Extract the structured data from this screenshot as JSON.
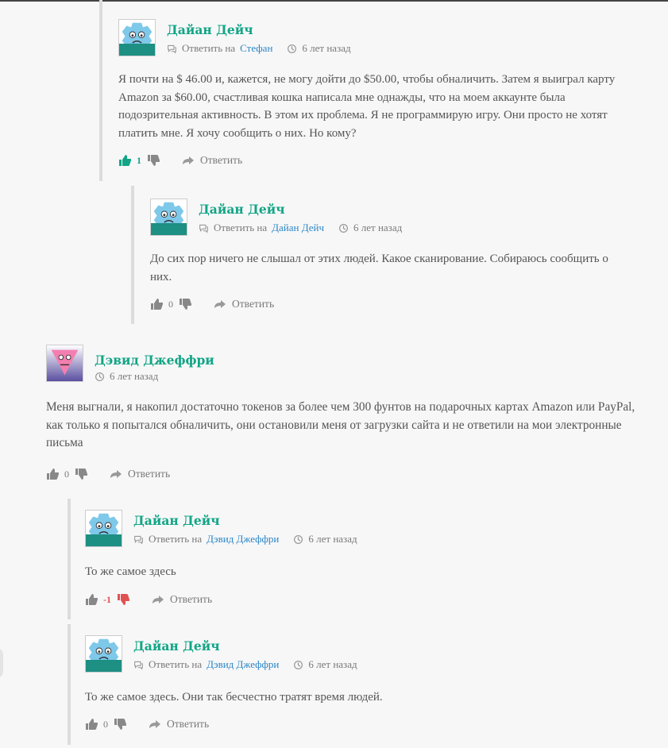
{
  "comments": [
    {
      "author": "Дайан Дейч",
      "reply_label": "Ответить на",
      "reply_to": "Стефан",
      "time": "6 лет назад",
      "text": "Я почти на $ 46.00 и, кажется, не могу дойти до $50.00, чтобы обналичить. Затем я выиграл карту Amazon за $60.00, счастливая кошка написала мне однажды, что на моем аккаунте была подозрительная активность. В этом их проблема. Я не программирую игру. Они просто не хотят платить мне. Я хочу сообщить о них. Но кому?",
      "votes": "1",
      "reply_button": "Ответить",
      "avatar": "gear-face-icon"
    },
    {
      "author": "Дайан Дейч",
      "reply_label": "Ответить на",
      "reply_to": "Дайан Дейч",
      "time": "6 лет назад",
      "text": "До сих пор ничего не слышал от этих людей. Какое сканирование. Собираюсь сообщить о них.",
      "votes": "0",
      "reply_button": "Ответить",
      "avatar": "gear-face-icon"
    },
    {
      "author": "Дэвид Джеффри",
      "time": "6 лет назад",
      "text": "Меня выгнали, я накопил достаточно токенов за более чем 300 фунтов на подарочных картах Amazon или PayPal, как только я попытался обналичить, они остановили меня от загрузки сайта и не ответили на мои электронные письма",
      "votes": "0",
      "reply_button": "Ответить",
      "avatar": "triangle-face-icon"
    },
    {
      "author": "Дайан Дейч",
      "reply_label": "Ответить на",
      "reply_to": "Дэвид Джеффри",
      "time": "6 лет назад",
      "text": "То же самое здесь",
      "votes": "-1",
      "reply_button": "Ответить",
      "avatar": "gear-face-icon"
    },
    {
      "author": "Дайан Дейч",
      "reply_label": "Ответить на",
      "reply_to": "Дэвид Джеффри",
      "time": "6 лет назад",
      "text": "То же самое здесь. Они так бесчестно тратят время людей.",
      "votes": "0",
      "reply_button": "Ответить",
      "avatar": "gear-face-icon"
    }
  ],
  "colors": {
    "author": "#12a585",
    "link": "#2b86c5",
    "upvote_active": "#12a585",
    "downvote_active": "#e05252",
    "nested_border": "#dcdcdc"
  }
}
